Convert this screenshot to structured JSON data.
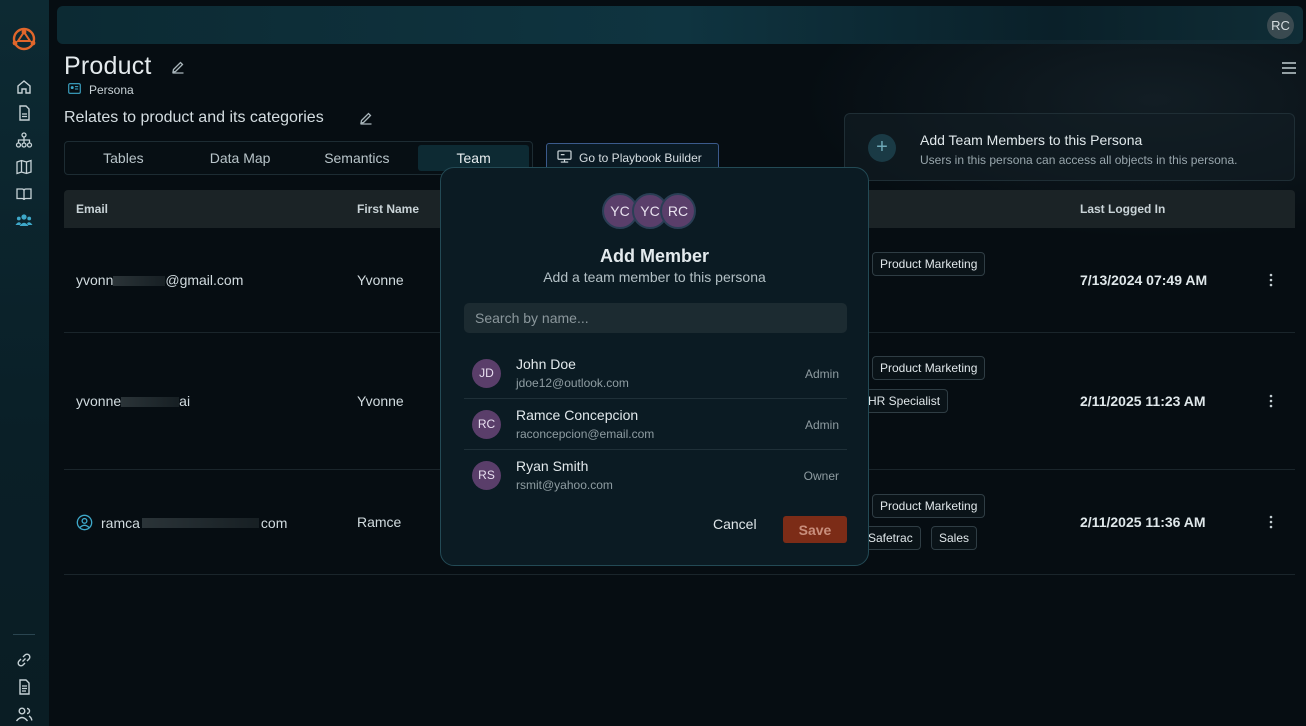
{
  "topbar": {
    "user_initials": "RC"
  },
  "page": {
    "title": "Product",
    "type_label": "Persona",
    "description": "Relates to product and its categories"
  },
  "tabs": [
    {
      "label": "Tables"
    },
    {
      "label": "Data Map"
    },
    {
      "label": "Semantics"
    },
    {
      "label": "Team",
      "active": true
    }
  ],
  "playbook_button": {
    "label": "Go to Playbook Builder"
  },
  "team_card": {
    "title": "Add Team Members to this Persona",
    "subtitle": "Users in this persona can access all objects in this persona."
  },
  "table": {
    "columns": [
      "Email",
      "First Name",
      "Last Logged In"
    ],
    "rows": [
      {
        "email_start": "yvonn",
        "email_end": "@gmail.com",
        "first_name": "Yvonne",
        "tags": [
          "Product Marketing"
        ],
        "last_logged_in": "7/13/2024 07:49 AM"
      },
      {
        "email_start": "yvonne",
        "email_end": "ai",
        "first_name": "Yvonne",
        "tags": [
          "Product Marketing",
          "HR Specialist"
        ],
        "last_logged_in": "2/11/2025 11:23 AM"
      },
      {
        "email_start": "ramca",
        "email_end": "com",
        "first_name": "Ramce",
        "tags": [
          "Product Marketing",
          "Safetrac",
          "Sales"
        ],
        "last_logged_in": "2/11/2025 11:36 AM"
      }
    ]
  },
  "modal": {
    "avatars": [
      "YC",
      "YC",
      "RC"
    ],
    "title": "Add Member",
    "subtitle": "Add a team member to this persona",
    "search_placeholder": "Search by name...",
    "members": [
      {
        "initials": "JD",
        "name": "John Doe",
        "email": "jdoe12@outlook.com",
        "role": "Admin"
      },
      {
        "initials": "RC",
        "name": "Ramce Concepcion",
        "email": "raconcepcion@email.com",
        "role": "Admin"
      },
      {
        "initials": "RS",
        "name": "Ryan Smith",
        "email": "rsmit@yahoo.com",
        "role": "Owner"
      }
    ],
    "cancel_label": "Cancel",
    "save_label": "Save"
  },
  "colors": {
    "accent": "#3ea8c9",
    "logo": "#e0662b",
    "save_button": "#7c2c17",
    "avatar": "#5a3e6a"
  }
}
